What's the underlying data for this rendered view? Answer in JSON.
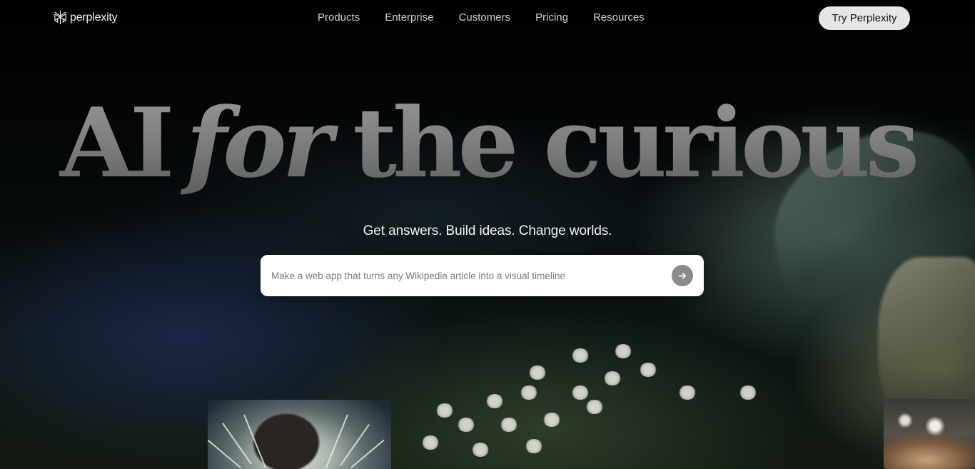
{
  "brand": {
    "name": "perplexity",
    "logo_icon": "perplexity-logo-icon"
  },
  "nav": {
    "items": [
      {
        "label": "Products"
      },
      {
        "label": "Enterprise"
      },
      {
        "label": "Customers"
      },
      {
        "label": "Pricing"
      },
      {
        "label": "Resources"
      }
    ],
    "cta_label": "Try Perplexity"
  },
  "hero": {
    "headline": {
      "word1": "AI",
      "word2": "for",
      "word3": "the curious"
    },
    "subtitle": "Get answers. Build ideas. Change worlds.",
    "search": {
      "placeholder": "Make a web app that turns any Wikipedia article into a visual timeline",
      "submit_icon": "arrow-right-icon"
    }
  },
  "colors": {
    "background": "#000000",
    "cta_background": "#e6e6e6",
    "search_background": "#ffffff",
    "submit_button": "#8b8b8b"
  }
}
